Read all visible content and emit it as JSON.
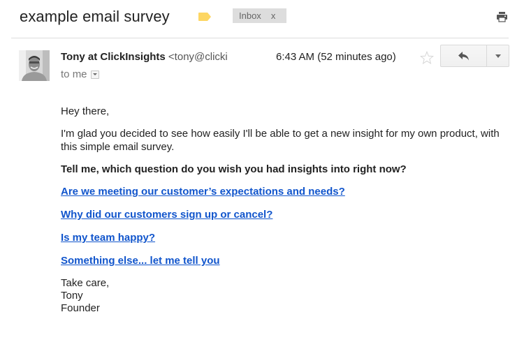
{
  "thread": {
    "subject": "example email survey",
    "importance_marker_color": "#fdd663",
    "labels": [
      {
        "name": "Inbox",
        "remove_label": "x"
      }
    ],
    "print_icon": "print-icon"
  },
  "message": {
    "sender_name": "Tony at ClickInsights",
    "sender_email_visible": "<tony@clicki",
    "recipient_prefix": "to",
    "recipient": "me",
    "timestamp": "6:43 AM (52 minutes ago)",
    "star_icon": "star-outline-icon",
    "reply_icon": "reply-icon",
    "more_icon": "chevron-down-icon"
  },
  "body": {
    "greeting": "Hey there,",
    "intro": "I'm glad you decided to see how easily I'll be able to get a new insight for my own product, with this simple email survey.",
    "question": "Tell me, which question do you wish you had insights into right now?",
    "answers": [
      "Are we meeting our customer’s expectations and needs?",
      "Why did our customers sign up or cancel?",
      "Is my team happy?",
      "Something else... let me tell you"
    ],
    "signoff": [
      "Take care,",
      "Tony",
      "Founder"
    ]
  },
  "colors": {
    "link": "#1155cc",
    "label_bg": "#dddddd",
    "text": "#222222"
  }
}
